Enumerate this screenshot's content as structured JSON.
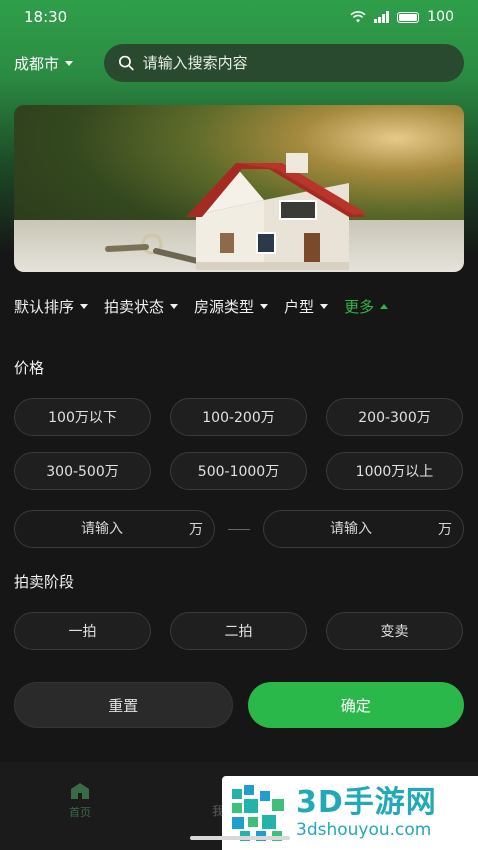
{
  "status": {
    "time": "18:30",
    "battery": "100"
  },
  "header": {
    "city": "成都市",
    "search_placeholder": "请输入搜索内容"
  },
  "filters": [
    {
      "label": "默认排序"
    },
    {
      "label": "拍卖状态"
    },
    {
      "label": "房源类型"
    },
    {
      "label": "户型"
    },
    {
      "label": "更多"
    }
  ],
  "price": {
    "title": "价格",
    "options": [
      "100万以下",
      "100-200万",
      "200-300万",
      "300-500万",
      "500-1000万",
      "1000万以上"
    ],
    "min_placeholder": "请输入",
    "max_placeholder": "请输入",
    "unit": "万"
  },
  "stage": {
    "title": "拍卖阶段",
    "options": [
      "一拍",
      "二拍",
      "变卖"
    ]
  },
  "actions": {
    "reset": "重置",
    "confirm": "确定"
  },
  "nav": {
    "home": "首页",
    "second_partial": "我"
  },
  "watermark": {
    "brand": "3D手游网",
    "domain": "3dshouyou.com"
  },
  "colors": {
    "accent": "#2bb84a",
    "header_green": "#2f9f4a"
  }
}
